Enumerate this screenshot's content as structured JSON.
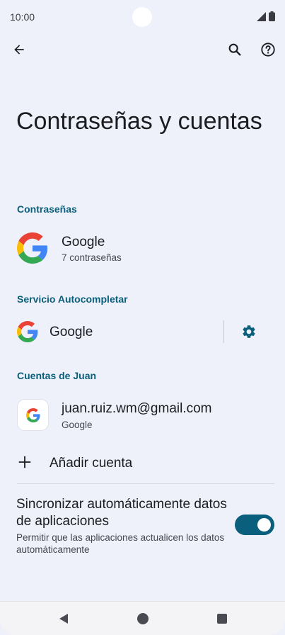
{
  "status_bar": {
    "time": "10:00"
  },
  "header": {
    "title": "Contraseñas y cuentas"
  },
  "passwords": {
    "section_label": "Contraseñas",
    "provider_name": "Google",
    "provider_count": "7 contraseñas"
  },
  "autofill": {
    "section_label": "Servicio Autocompletar",
    "service_name": "Google"
  },
  "accounts": {
    "section_label": "Cuentas de Juan",
    "items": [
      {
        "email": "juan.ruiz.wm@gmail.com",
        "type": "Google"
      }
    ],
    "add_label": "Añadir cuenta"
  },
  "sync": {
    "title": "Sincronizar automáticamente datos de aplicaciones",
    "description": "Permitir que las aplicaciones actualicen los datos automáticamente",
    "enabled": true
  },
  "colors": {
    "accent": "#0a5f7c",
    "background": "#eef1f9"
  },
  "icons": [
    "arrow-back-icon",
    "search-icon",
    "help-icon",
    "google-logo-icon",
    "gear-icon",
    "plus-icon",
    "toggle-switch",
    "nav-back-icon",
    "nav-home-icon",
    "nav-recents-icon"
  ]
}
